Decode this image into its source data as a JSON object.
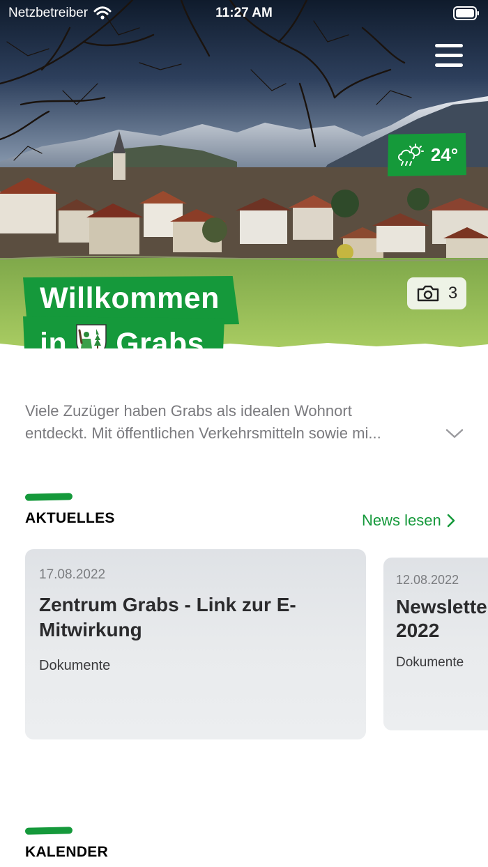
{
  "status_bar": {
    "carrier": "Netzbetreiber",
    "time": "11:27 AM"
  },
  "hero": {
    "weather_temperature": "24°",
    "weather_icon": "cloud-rain-sun-icon",
    "photo_count": "3",
    "welcome_line1": "Willkommen",
    "welcome_line2_prefix": "in",
    "welcome_line2_name": "Grabs"
  },
  "intro": {
    "line1": "Viele Zuzüger haben Grabs als idealen Wohnort",
    "line2": "entdeckt. Mit öffentlichen Verkehrsmitteln sowie mi..."
  },
  "news": {
    "section_title": "AKTUELLES",
    "link_label": "News lesen",
    "cards": [
      {
        "date": "17.08.2022",
        "title_line1": "Zentrum Grabs - Link zur E-",
        "title_line2": "Mitwirkung",
        "category": "Dokumente"
      },
      {
        "date": "12.08.2022",
        "title_line1": "Newslette",
        "title_line2": "2022",
        "category": "Dokumente"
      }
    ]
  },
  "calendar": {
    "section_title": "KALENDER"
  },
  "colors": {
    "brand_green": "#15993b",
    "text_muted": "#7b7b7f"
  }
}
